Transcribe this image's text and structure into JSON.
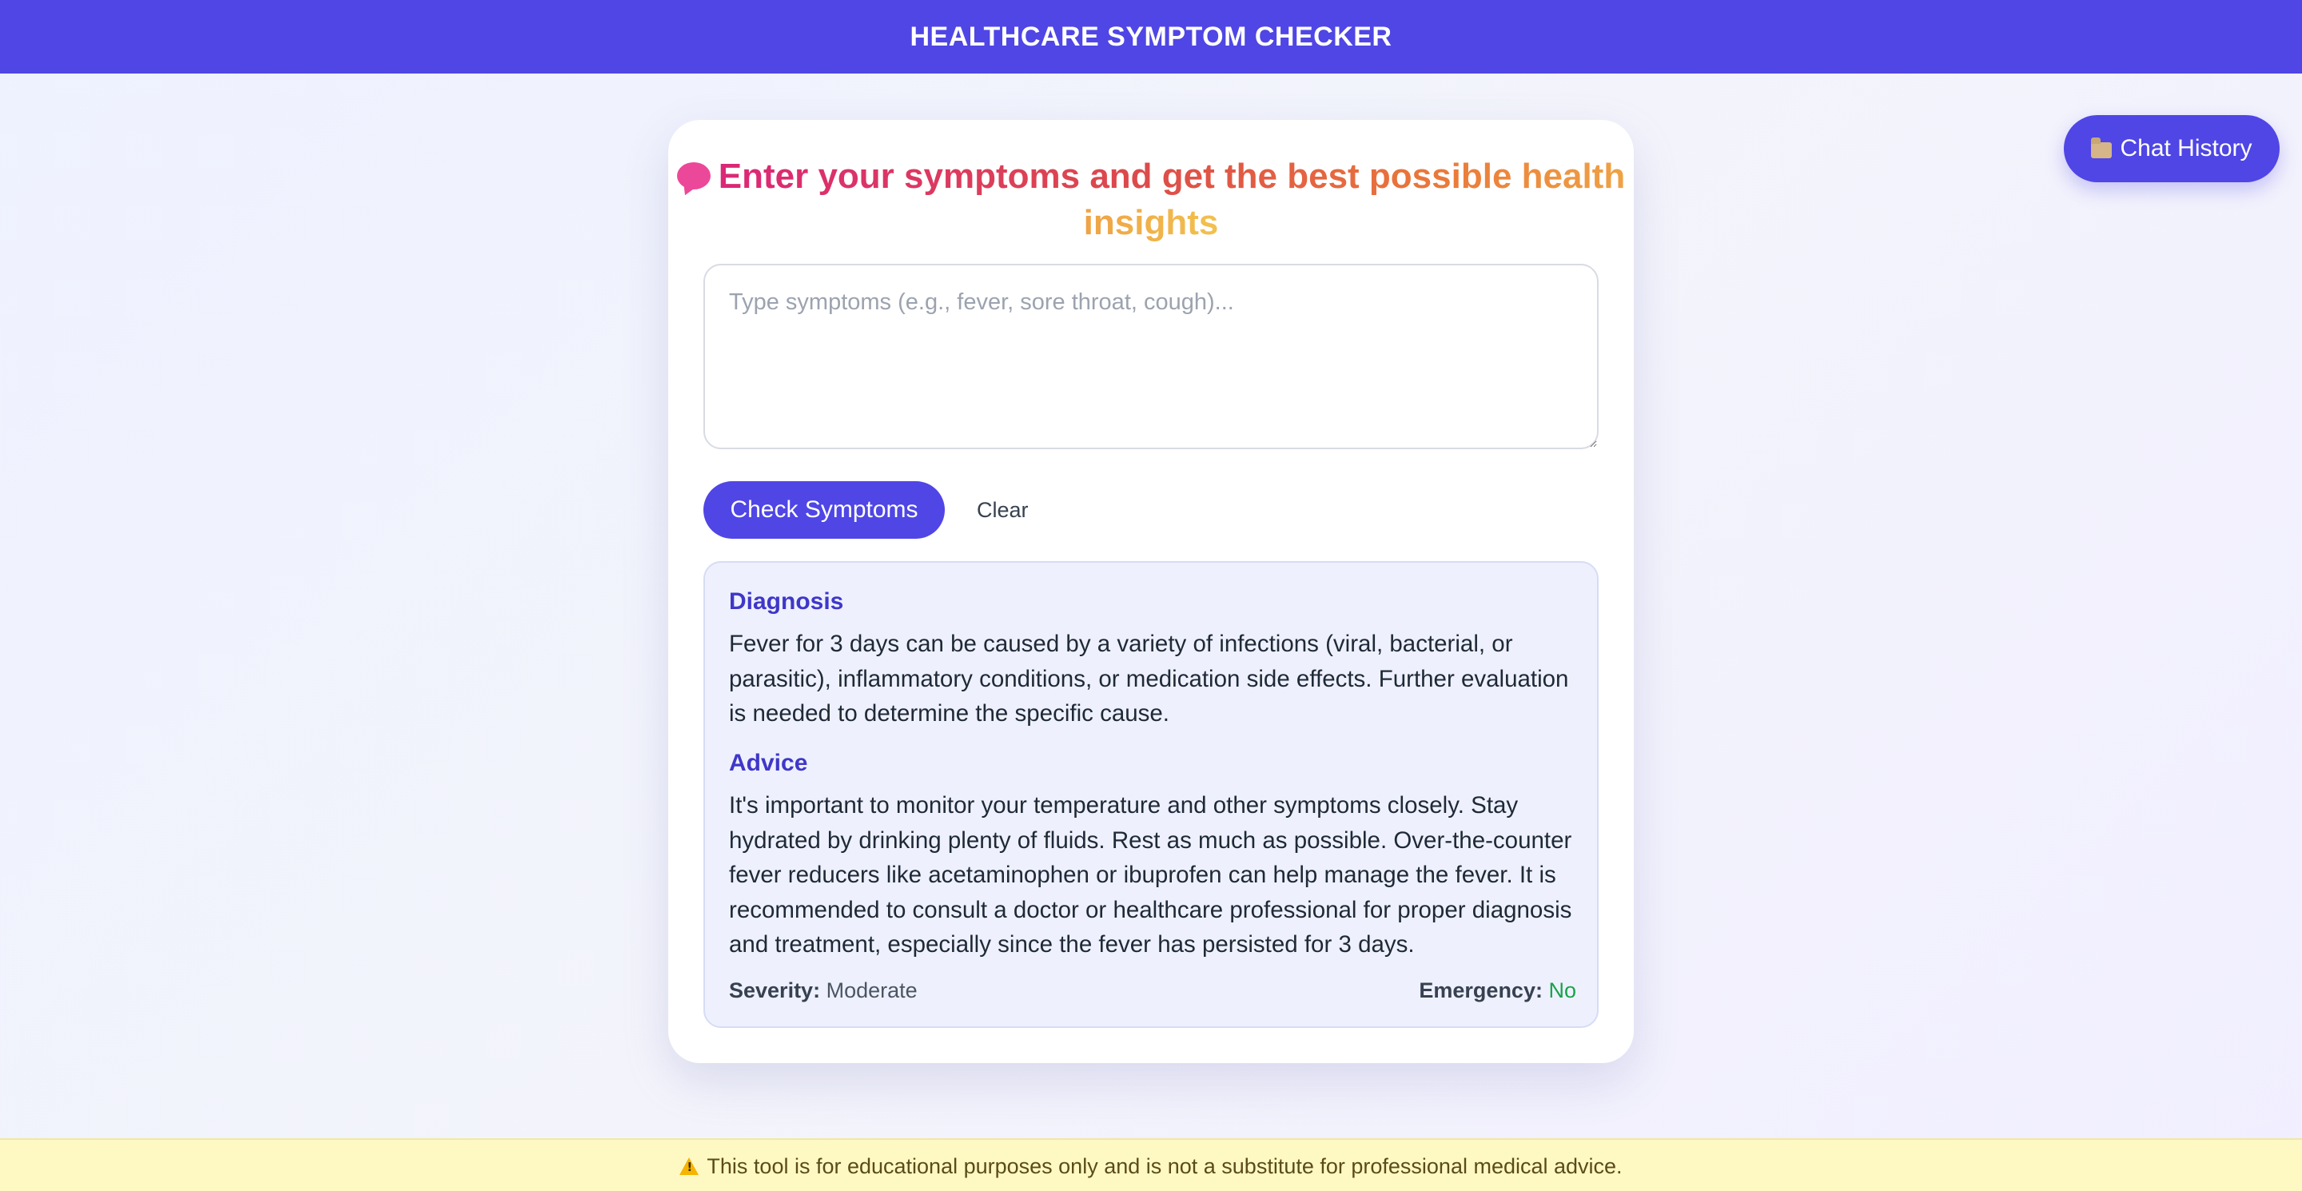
{
  "header": {
    "title": "HEALTHCARE SYMPTOM CHECKER"
  },
  "history_button": {
    "icon": "folder-icon",
    "label": "Chat History"
  },
  "card": {
    "heading_icon": "speech-bubble-icon",
    "heading": "Enter your symptoms and get the best possible health insights",
    "input": {
      "placeholder": "Type symptoms (e.g., fever, sore throat, cough)...",
      "value": ""
    },
    "check_label": "Check Symptoms",
    "clear_label": "Clear"
  },
  "results": {
    "diagnosis_title": "Diagnosis",
    "diagnosis_text": "Fever for 3 days can be caused by a variety of infections (viral, bacterial, or parasitic), inflammatory conditions, or medication side effects. Further evaluation is needed to determine the specific cause.",
    "advice_title": "Advice",
    "advice_text": "It's important to monitor your temperature and other symptoms closely. Stay hydrated by drinking plenty of fluids. Rest as much as possible. Over-the-counter fever reducers like acetaminophen or ibuprofen can help manage the fever. It is recommended to consult a doctor or healthcare professional for proper diagnosis and treatment, especially since the fever has persisted for 3 days.",
    "severity_label": "Severity:",
    "severity_value": "Moderate",
    "emergency_label": "Emergency:",
    "emergency_value": "No"
  },
  "footer": {
    "icon": "warning-icon",
    "text": "This tool is for educational purposes only and is not a substitute for professional medical advice."
  },
  "colors": {
    "primary": "#4f46e5",
    "accent_title": "#3f37c9",
    "emergency_no": "#16a34a",
    "footer_bg": "#fef9c3"
  }
}
